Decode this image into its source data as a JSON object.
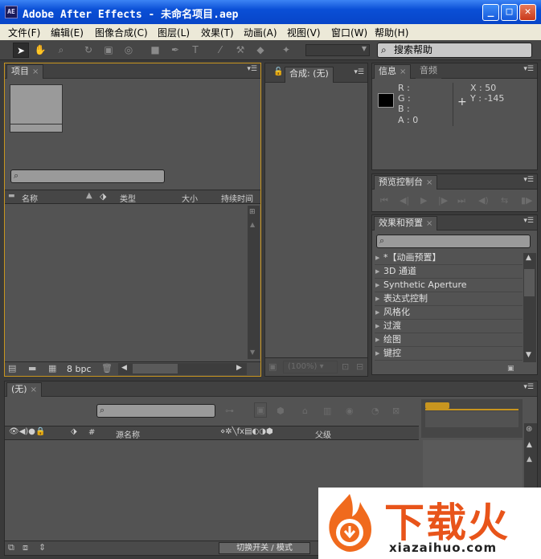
{
  "window": {
    "title": "Adobe After Effects - 未命名项目.aep",
    "app_icon": "AE",
    "min": "_",
    "max": "□",
    "close": "✕"
  },
  "menu": [
    "文件(F)",
    "编辑(E)",
    "图像合成(C)",
    "图层(L)",
    "效果(T)",
    "动画(A)",
    "视图(V)",
    "窗口(W)",
    "帮助(H)"
  ],
  "search_help": {
    "placeholder": "搜索帮助"
  },
  "project": {
    "tab": "项目",
    "columns": [
      "名称",
      "类型",
      "大小",
      "持续时间"
    ],
    "bpc": "8 bpc"
  },
  "comp": {
    "tab": "合成: (无)",
    "zoom": "(100%)"
  },
  "info": {
    "tabs": [
      "信息",
      "音频"
    ],
    "r": "R :",
    "g": "G :",
    "b": "B :",
    "a": "A : 0",
    "x": "X : 50",
    "y": "Y : -145"
  },
  "preview": {
    "tab": "预览控制台"
  },
  "effects": {
    "tab": "效果和预置",
    "items": [
      "*【动画预置】",
      "3D 通道",
      "Synthetic Aperture",
      "表达式控制",
      "风格化",
      "过渡",
      "绘图",
      "键控"
    ]
  },
  "timeline": {
    "tab": "(无)",
    "layer_name_col": "源名称",
    "parent_col": "父级",
    "number_col": "#",
    "toggle_btn": "切换开关 / 模式"
  },
  "watermark": {
    "brand": "下载火",
    "url": "xiazaihuo.com"
  },
  "colors": {
    "panel": "#535353",
    "accent": "#c8951f",
    "title": "#0a4fd6"
  }
}
